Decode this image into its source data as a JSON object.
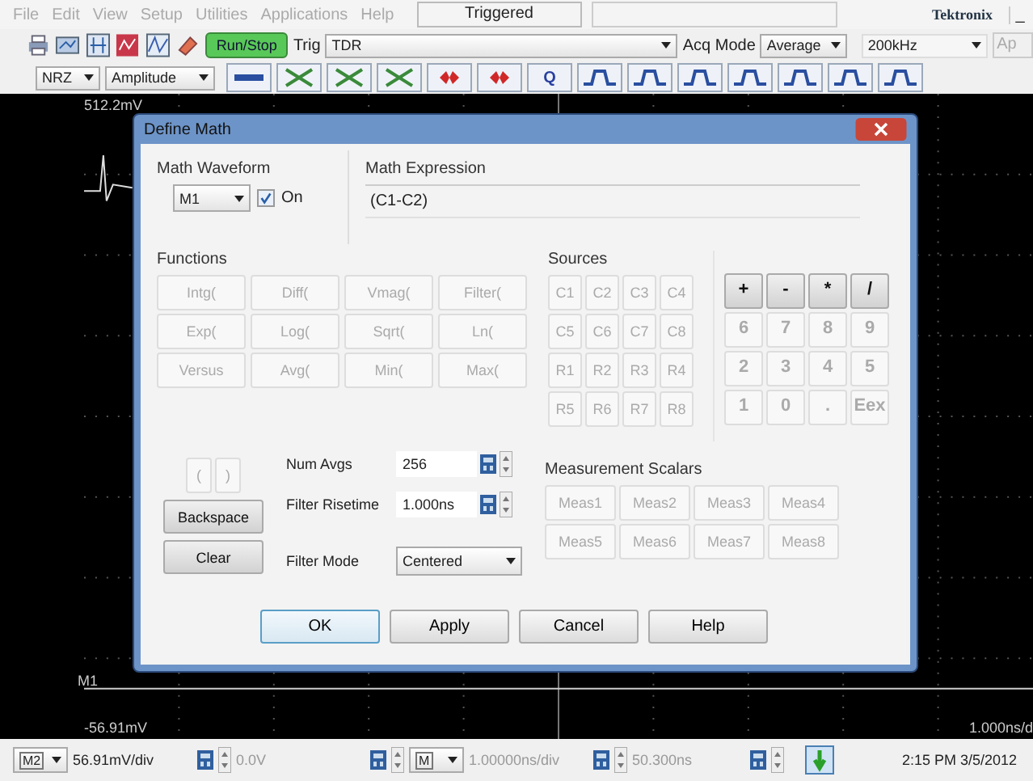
{
  "menu": [
    {
      "label": "File",
      "disabled": true
    },
    {
      "label": "Edit",
      "disabled": true
    },
    {
      "label": "View",
      "disabled": true
    },
    {
      "label": "Setup",
      "disabled": true
    },
    {
      "label": "Utilities",
      "disabled": true
    },
    {
      "label": "Applications",
      "disabled": true
    },
    {
      "label": "Help",
      "disabled": true
    }
  ],
  "trigger_status": "Triggered",
  "brand": "Tektronix",
  "window_minimize": "_",
  "toolbar": {
    "run_stop": "Run/Stop",
    "trig_label": "Trig",
    "trig_value": "TDR",
    "acq_label": "Acq Mode",
    "acq_value": "Average",
    "rate_value": "200kHz",
    "cut_button": "Ap"
  },
  "toolbar2": {
    "coding": "NRZ",
    "measure": "Amplitude",
    "q_button": "Q"
  },
  "scope": {
    "top_label": "512.2mV",
    "trace_label": "M1",
    "bottom_label": "-56.91mV",
    "timebase": "1.000ns/d"
  },
  "dialog": {
    "title": "Define Math",
    "math_waveform": {
      "label": "Math Waveform",
      "value": "M1",
      "on_label": "On",
      "checked": true
    },
    "math_expression": {
      "label": "Math Expression",
      "value": "(C1-C2)"
    },
    "functions_label": "Functions",
    "functions": [
      {
        "label": "Intg(",
        "disabled": true
      },
      {
        "label": "Diff(",
        "disabled": true
      },
      {
        "label": "Vmag(",
        "disabled": true
      },
      {
        "label": "Filter(",
        "disabled": true
      },
      {
        "label": "Exp(",
        "disabled": true
      },
      {
        "label": "Log(",
        "disabled": true
      },
      {
        "label": "Sqrt(",
        "disabled": true
      },
      {
        "label": "Ln(",
        "disabled": true
      },
      {
        "label": "Versus",
        "disabled": true
      },
      {
        "label": "Avg(",
        "disabled": true
      },
      {
        "label": "Min(",
        "disabled": true
      },
      {
        "label": "Max(",
        "disabled": true
      }
    ],
    "sources_label": "Sources",
    "sources": [
      {
        "label": "C1",
        "disabled": true
      },
      {
        "label": "C2",
        "disabled": true
      },
      {
        "label": "C3",
        "disabled": true
      },
      {
        "label": "C4",
        "disabled": true
      },
      {
        "label": "C5",
        "disabled": true
      },
      {
        "label": "C6",
        "disabled": true
      },
      {
        "label": "C7",
        "disabled": true
      },
      {
        "label": "C8",
        "disabled": true
      },
      {
        "label": "R1",
        "disabled": true
      },
      {
        "label": "R2",
        "disabled": true
      },
      {
        "label": "R3",
        "disabled": true
      },
      {
        "label": "R4",
        "disabled": true
      },
      {
        "label": "R5",
        "disabled": true
      },
      {
        "label": "R6",
        "disabled": true
      },
      {
        "label": "R7",
        "disabled": true
      },
      {
        "label": "R8",
        "disabled": true
      }
    ],
    "keypad": [
      {
        "label": "+",
        "disabled": false
      },
      {
        "label": "-",
        "disabled": false
      },
      {
        "label": "*",
        "disabled": false
      },
      {
        "label": "/",
        "disabled": false
      },
      {
        "label": "6",
        "disabled": true
      },
      {
        "label": "7",
        "disabled": true
      },
      {
        "label": "8",
        "disabled": true
      },
      {
        "label": "9",
        "disabled": true
      },
      {
        "label": "2",
        "disabled": true
      },
      {
        "label": "3",
        "disabled": true
      },
      {
        "label": "4",
        "disabled": true
      },
      {
        "label": "5",
        "disabled": true
      },
      {
        "label": "1",
        "disabled": true
      },
      {
        "label": "0",
        "disabled": true
      },
      {
        "label": ".",
        "disabled": true
      },
      {
        "label": "Eex",
        "disabled": true
      }
    ],
    "parens": [
      {
        "label": "(",
        "disabled": true
      },
      {
        "label": ")",
        "disabled": true
      }
    ],
    "edit_buttons": [
      {
        "label": "Backspace",
        "disabled": false
      },
      {
        "label": "Clear",
        "disabled": false
      }
    ],
    "num_avgs": {
      "label": "Num Avgs",
      "value": "256"
    },
    "filter_risetime": {
      "label": "Filter Risetime",
      "value": "1.000ns"
    },
    "filter_mode": {
      "label": "Filter Mode",
      "value": "Centered"
    },
    "measurement_label": "Measurement Scalars",
    "measurements": [
      {
        "label": "Meas1",
        "disabled": true
      },
      {
        "label": "Meas2",
        "disabled": true
      },
      {
        "label": "Meas3",
        "disabled": true
      },
      {
        "label": "Meas4",
        "disabled": true
      },
      {
        "label": "Meas5",
        "disabled": true
      },
      {
        "label": "Meas6",
        "disabled": true
      },
      {
        "label": "Meas7",
        "disabled": true
      },
      {
        "label": "Meas8",
        "disabled": true
      }
    ],
    "buttons": [
      {
        "label": "OK",
        "selected": true
      },
      {
        "label": "Apply",
        "selected": false
      },
      {
        "label": "Cancel",
        "selected": false
      },
      {
        "label": "Help",
        "selected": false
      }
    ]
  },
  "status_bar": {
    "source": "M2",
    "vertical_scale": "56.91mV/div",
    "offset": "0.0V",
    "math_source": "M",
    "horizontal_scale": "1.00000ns/div",
    "position": "50.300ns",
    "datetime": "2:15 PM 3/5/2012"
  }
}
